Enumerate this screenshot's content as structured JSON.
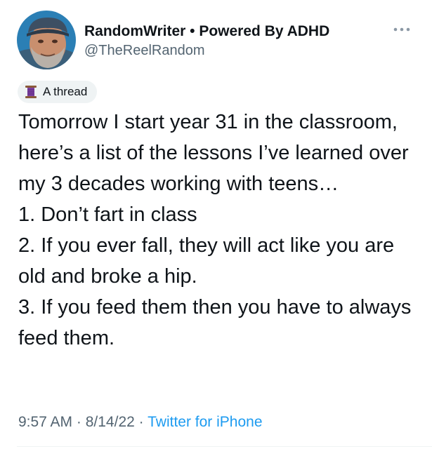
{
  "user": {
    "display_name": "RandomWriter",
    "separator": " • ",
    "bio_tag": "Powered By ADHD",
    "handle": "@TheReelRandom",
    "avatar_icon": "profile-photo"
  },
  "more_icon": "more-options-icon",
  "thread_badge": {
    "icon": "spool-of-thread-icon",
    "label": "A thread"
  },
  "tweet": {
    "text": "Tomorrow I start year 31 in the classroom, here’s a list of the lessons I’ve learned over my 3 decades working with teens…\n1. Don’t fart in class\n2. If you ever fall, they will act like you are old and broke a hip.\n3. If you feed them then you have to always feed them."
  },
  "meta": {
    "time": "9:57 AM",
    "dot1": " · ",
    "date": "8/14/22",
    "dot2": " · ",
    "source": "Twitter for iPhone"
  },
  "colors": {
    "text": "#0f1419",
    "secondary": "#536471",
    "link": "#1d9bf0",
    "badge_bg": "#eff3f4"
  }
}
